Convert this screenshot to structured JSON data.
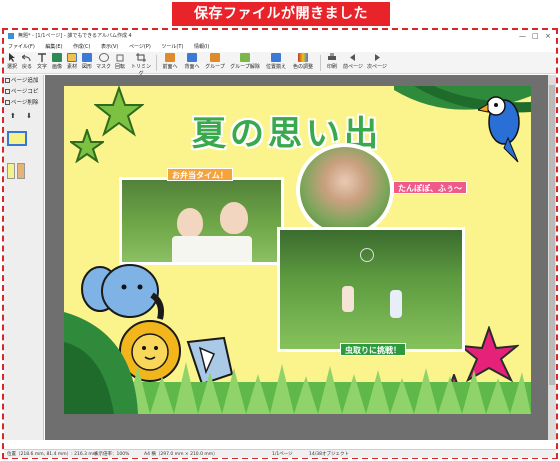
{
  "banner": {
    "text": "保存ファイルが開きました"
  },
  "window": {
    "title": "無題* - [1/1ページ] - 誰でもできるアルバム作成 4",
    "controls": {
      "minimize": "—",
      "maximize": "□",
      "close": "×"
    }
  },
  "menu": [
    "ファイル(F)",
    "編集(E)",
    "作成(C)",
    "表示(V)",
    "ページ(P)",
    "ツール(T)",
    "情報(I)"
  ],
  "toolbar": [
    {
      "label": "選択",
      "icon": "cursor-icon",
      "color": "#333333"
    },
    {
      "label": "戻る",
      "icon": "undo-icon",
      "color": "#555555"
    },
    {
      "label": "文字",
      "icon": "text-icon",
      "color": "#444444"
    },
    {
      "label": "画像",
      "icon": "image-icon",
      "color": "#2e8b57"
    },
    {
      "label": "素材",
      "icon": "material-icon",
      "color": "#3b7bd6"
    },
    {
      "label": "図形",
      "icon": "shape-icon",
      "color": "#3b7bd6"
    },
    {
      "label": "マスク",
      "icon": "mask-icon",
      "color": "#666666"
    },
    {
      "label": "回転",
      "icon": "rotate-icon",
      "color": "#666666"
    },
    {
      "label": "トリミング",
      "icon": "crop-icon",
      "color": "#444444"
    },
    {
      "label": "前面へ",
      "icon": "bring-front-icon",
      "color": "#e08a2a"
    },
    {
      "label": "背面へ",
      "icon": "send-back-icon",
      "color": "#3b7bd6"
    },
    {
      "label": "グループ",
      "icon": "group-icon",
      "color": "#e08a2a"
    },
    {
      "label": "グループ解除",
      "icon": "ungroup-icon",
      "color": "#7ab648"
    },
    {
      "label": "位置揃え",
      "icon": "align-icon",
      "color": "#3b7bd6"
    },
    {
      "label": "色の調整",
      "icon": "color-adjust-icon",
      "color": "#c0392b"
    },
    {
      "label": "印刷",
      "icon": "print-icon",
      "color": "#555555"
    },
    {
      "label": "前ページ",
      "icon": "prev-page-icon",
      "color": "#555555"
    },
    {
      "label": "次ページ",
      "icon": "next-page-icon",
      "color": "#555555"
    }
  ],
  "sidebar": {
    "add_page": "ページ追加",
    "copy_page": "ページコピー",
    "delete_page": "ページ削除",
    "up_arrow": "⬆",
    "down_arrow": "⬇"
  },
  "album": {
    "title": "夏の思い出",
    "captions": {
      "lunch": "お弁当タイム！",
      "dandelion": "たんぽぽ、ふぅ～",
      "bugs": "虫取りに挑戦！"
    }
  },
  "status": {
    "position": "位置（218.6 mm, 81.4 mm）: 216.3 mm",
    "zoom": "表示倍率：100%",
    "paper": "A4 横（297.0 mm × 210.0 mm）",
    "page": "1/1ページ",
    "objects": "14/38オブジェクト"
  },
  "colors": {
    "banner": "#e8232a",
    "page_background": "#fbf38b",
    "title_text": "#3aa84c",
    "workspace": "#6f6f6f",
    "frame_dash": "#d62828"
  }
}
